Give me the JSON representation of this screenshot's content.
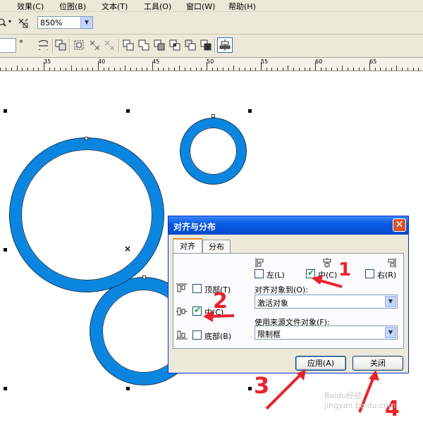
{
  "menu": [
    "效果(C)",
    "位图(B)",
    "文本(T)",
    "工具(O)",
    "窗口(W)",
    "帮助(H)"
  ],
  "zoom": {
    "value": "850%"
  },
  "rotation": {
    "unit": "°"
  },
  "ruler": {
    "labels": [
      "35",
      "40",
      "45",
      "50",
      "55",
      "60",
      "65"
    ]
  },
  "dialog": {
    "title": "对齐与分布",
    "tabs": [
      "对齐",
      "分布"
    ],
    "horizontal": {
      "left": {
        "label": "左(L)",
        "checked": false
      },
      "center": {
        "label": "中(C)",
        "checked": true
      },
      "right": {
        "label": "右(R)",
        "checked": false
      }
    },
    "vertical": {
      "top": {
        "label": "顶部(T)",
        "checked": false
      },
      "center": {
        "label": "中(C)",
        "checked": true
      },
      "bottom": {
        "label": "底部(B)",
        "checked": false
      }
    },
    "align_to": {
      "label": "对齐对象到(O):",
      "value": "激活对象"
    },
    "source": {
      "label": "使用来源文件对象(F):",
      "value": "限制框"
    },
    "apply_label": "应用(A)",
    "close_label": "关闭"
  },
  "annotations": [
    "1",
    "2",
    "3",
    "4"
  ],
  "watermark": "Baidu经验 jingyan.baidu.com"
}
